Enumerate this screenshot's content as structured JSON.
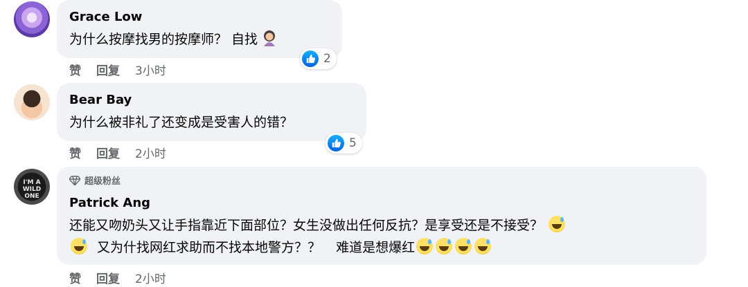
{
  "comments": [
    {
      "author": "Grace Low",
      "text": "为什么按摩找男的按摩师？ 自找",
      "text_emoji": "person-emoji",
      "reactions": "2",
      "like": "赞",
      "reply": "回复",
      "time": "3小时"
    },
    {
      "author": "Bear Bay",
      "text": "为什么被非礼了还变成是受害人的错？",
      "reactions": "5",
      "like": "赞",
      "reply": "回复",
      "time": "2小时"
    },
    {
      "badge": "超级粉丝",
      "author": "Patrick Ang",
      "line1": "还能又吻奶头又让手指靠近下面部位？女生没做出任何反抗？是享受还是不接受？",
      "line2a": "又为什找网红求助而不找本地警方？？",
      "line2b": "难道是想爆红",
      "like": "赞",
      "reply": "回复",
      "time": "2小时"
    }
  ],
  "icons": {
    "like": "thumbs-up-icon",
    "badge": "diamond-icon",
    "emoji": "grinning-sweat-emoji"
  },
  "colors": {
    "bubble": "#f0f2f5",
    "like_blue": "#0866ff",
    "secondary_text": "#65676b"
  }
}
